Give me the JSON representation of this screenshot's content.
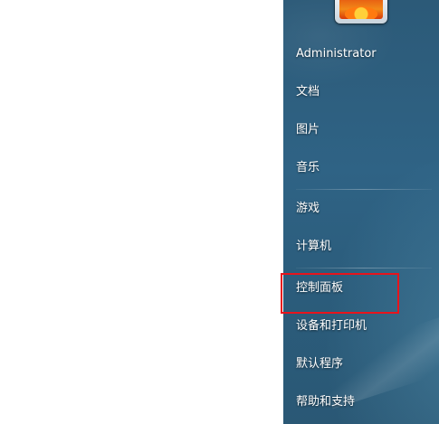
{
  "start_menu": {
    "user_name": "Administrator",
    "items": [
      {
        "label": "文档"
      },
      {
        "label": "图片"
      },
      {
        "label": "音乐"
      },
      {
        "label": "游戏"
      },
      {
        "label": "计算机"
      },
      {
        "label": "控制面板"
      },
      {
        "label": "设备和打印机"
      },
      {
        "label": "默认程序"
      },
      {
        "label": "帮助和支持"
      }
    ],
    "highlighted_item": "控制面板",
    "highlight_color": "#e8141c",
    "pane_color": "#2f6385"
  }
}
